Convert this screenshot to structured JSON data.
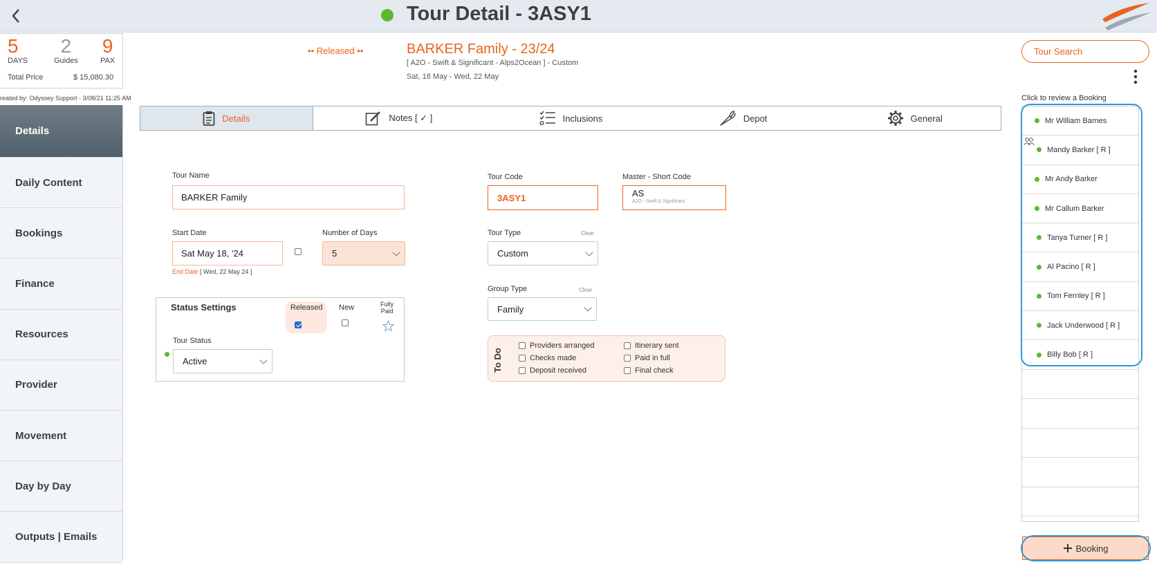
{
  "header": {
    "title": "Tour Detail - 3ASY1",
    "status_color": "#5db82f"
  },
  "summary": {
    "days": "5",
    "days_label": "DAYS",
    "guides": "2",
    "guides_label": "Guides",
    "pax": "9",
    "pax_label": "PAX",
    "total_price_label": "Total Price",
    "total_price": "$ 15,080.30",
    "created_by": "reated by: Odyssey Support - 3/08/21 11:25 AM"
  },
  "tour": {
    "released_label": "•• Released ••",
    "heading": "BARKER Family - 23/24",
    "subtitle": "[ A2O - Swift & Significant - Alps2Ocean ] - Custom",
    "dates": "Sat, 18 May  - Wed, 22 May"
  },
  "sidebar": {
    "items": [
      {
        "label": "Details"
      },
      {
        "label": "Daily Content"
      },
      {
        "label": "Bookings"
      },
      {
        "label": "Finance"
      },
      {
        "label": "Resources"
      },
      {
        "label": "Provider"
      },
      {
        "label": "Movement"
      },
      {
        "label": "Day by Day"
      },
      {
        "label": "Outputs | Emails"
      }
    ]
  },
  "tabs": [
    {
      "label": "Details",
      "icon": "clipboard-icon"
    },
    {
      "label": "Notes [ ✓ ]",
      "icon": "notepad-pen-icon"
    },
    {
      "label": "Inclusions",
      "icon": "checklist-icon"
    },
    {
      "label": "Depot",
      "icon": "carrot-icon"
    },
    {
      "label": "General",
      "icon": "gear-icon"
    }
  ],
  "form": {
    "tour_name_label": "Tour Name",
    "tour_name": "BARKER Family",
    "start_date_label": "Start Date",
    "start_date": "Sat May 18, '24",
    "num_days_label": "Number of Days",
    "num_days": "5",
    "end_date_prefix": "End Date",
    "end_date": "[ Wed, 22 May 24 ]",
    "tour_code_label": "Tour Code",
    "tour_code": "3ASY1",
    "master_label": "Master - Short Code",
    "master_code": "AS",
    "master_desc": "A2O - Swift & Significant",
    "tour_type_label": "Tour Type",
    "tour_type": "Custom",
    "clear_label": "Clear",
    "group_type_label": "Group Type",
    "group_type": "Family"
  },
  "status": {
    "title": "Status Settings",
    "released_label": "Released",
    "released_checked": true,
    "new_label": "New",
    "fully_paid_label_1": "Fully",
    "fully_paid_label_2": "Paid",
    "tour_status_label": "Tour Status",
    "tour_status": "Active"
  },
  "todo": {
    "title": "To Do",
    "items": [
      {
        "label": "Providers arranged",
        "checked": false
      },
      {
        "label": "Itinerary sent",
        "checked": false
      },
      {
        "label": "Checks made",
        "checked": false
      },
      {
        "label": "Paid in full",
        "checked": false
      },
      {
        "label": "Deposit received",
        "checked": false
      },
      {
        "label": "Final check",
        "checked": false
      }
    ]
  },
  "right_panel": {
    "tour_search": "Tour Search",
    "click_review": "Click to review a Booking",
    "bookings": [
      {
        "name": "Mr William Barnes"
      },
      {
        "name": "Mandy Barker  [ R ]"
      },
      {
        "name": "Mr Andy Barker"
      },
      {
        "name": "Mr Callum Barker"
      },
      {
        "name": "Tanya Turner  [ R ]"
      },
      {
        "name": "Al Pacino  [ R ]"
      },
      {
        "name": "Tom Fernley  [ R ]"
      },
      {
        "name": "Jack Underwood  [ R ]"
      },
      {
        "name": "Billy Bob  [ R ]"
      }
    ],
    "add_booking": "Booking"
  },
  "colors": {
    "accent": "#e8631c",
    "status_green": "#5db82f",
    "highlight_blue": "#2a9ad8"
  }
}
